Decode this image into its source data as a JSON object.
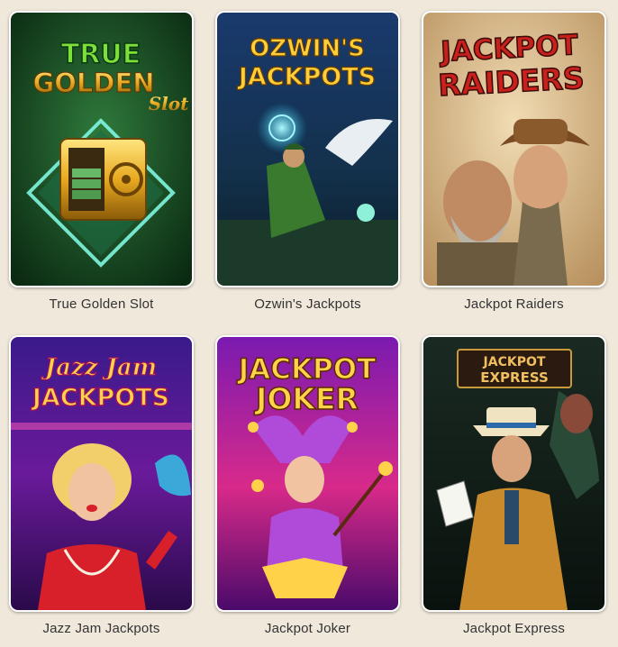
{
  "games": [
    {
      "title": "True Golden Slot",
      "logo_lines": [
        "TRUE",
        "GOLDEN",
        "Slot"
      ]
    },
    {
      "title": "Ozwin's Jackpots",
      "logo_lines": [
        "OZWIN'S",
        "JACKPOTS"
      ]
    },
    {
      "title": "Jackpot Raiders",
      "logo_lines": [
        "JACKPOT",
        "RAIDERS"
      ]
    },
    {
      "title": "Jazz Jam Jackpots",
      "logo_lines": [
        "Jazz Jam",
        "JACKPOTS"
      ]
    },
    {
      "title": "Jackpot Joker",
      "logo_lines": [
        "JACKPOT",
        "JOKER"
      ]
    },
    {
      "title": "Jackpot Express",
      "logo_lines": [
        "JACKPOT",
        "EXPRESS"
      ]
    }
  ],
  "colors": {
    "page_background": "#efe8db",
    "card_border": "#ffffff",
    "caption_text": "#333333"
  }
}
